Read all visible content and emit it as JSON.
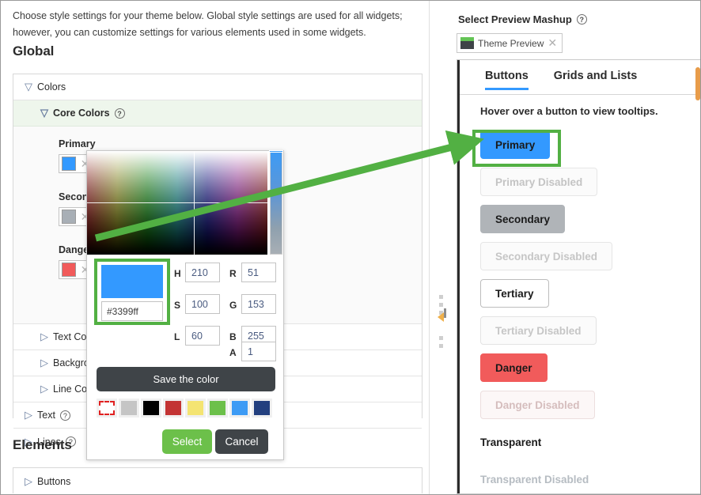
{
  "left": {
    "intro": "Choose style settings for your theme below. Global style settings are used for all widgets; however, you can customize settings for various elements used in some widgets.",
    "global_title": "Global",
    "elements_title": "Elements",
    "accordion": {
      "colors_label": "Colors",
      "core_colors_label": "Core Colors",
      "core_rows": [
        {
          "label": "Primary",
          "color": "#3399ff"
        },
        {
          "label": "Secondary",
          "color": "#a8afb6"
        },
        {
          "label": "Danger",
          "color": "#f15b5b"
        }
      ],
      "sub_rows": [
        {
          "label": "Text Colors"
        },
        {
          "label": "Background Colors"
        },
        {
          "label": "Line Colors"
        }
      ],
      "top_rows": [
        {
          "label": "Text"
        },
        {
          "label": "Lines"
        }
      ]
    },
    "elements_rows": [
      {
        "label": "Buttons"
      }
    ]
  },
  "picker": {
    "hex_value": "#3399ff",
    "preview_color": "#3399ff",
    "fields": [
      {
        "label": "H",
        "value": "210"
      },
      {
        "label": "S",
        "value": "100"
      },
      {
        "label": "L",
        "value": "60"
      },
      {
        "label": "R",
        "value": "51"
      },
      {
        "label": "G",
        "value": "153"
      },
      {
        "label": "B",
        "value": "255"
      },
      {
        "label": "A",
        "value": "1"
      }
    ],
    "save_label": "Save the color",
    "select_label": "Select",
    "cancel_label": "Cancel",
    "swatches": [
      {
        "name": "none",
        "color": "transparent"
      },
      {
        "name": "gray",
        "color": "#c5c5c5"
      },
      {
        "name": "black",
        "color": "#000000"
      },
      {
        "name": "red",
        "color": "#c33434"
      },
      {
        "name": "yellow",
        "color": "#f4e472"
      },
      {
        "name": "green",
        "color": "#6cc04a"
      },
      {
        "name": "blue",
        "color": "#3d9bf5"
      },
      {
        "name": "navy",
        "color": "#23407f"
      }
    ]
  },
  "right": {
    "mashup_label": "Select Preview Mashup",
    "chip_label": "Theme Preview",
    "tabs": [
      {
        "label": "Buttons",
        "active": true
      },
      {
        "label": "Grids and Lists",
        "active": false
      }
    ],
    "hover_hint": "Hover over a button to view tooltips.",
    "buttons": [
      {
        "label": "Primary",
        "style": "primary"
      },
      {
        "label": "Primary Disabled",
        "style": "primary-dis"
      },
      {
        "label": "Secondary",
        "style": "secondary"
      },
      {
        "label": "Secondary Disabled",
        "style": "secondary-dis"
      },
      {
        "label": "Tertiary",
        "style": "tertiary"
      },
      {
        "label": "Tertiary Disabled",
        "style": "tertiary-dis"
      },
      {
        "label": "Danger",
        "style": "danger"
      },
      {
        "label": "Danger Disabled",
        "style": "danger-dis"
      },
      {
        "label": "Transparent",
        "style": "transparent"
      },
      {
        "label": "Transparent Disabled",
        "style": "transparent-dis"
      }
    ]
  },
  "annotation": {
    "accent_color": "#52b043"
  }
}
